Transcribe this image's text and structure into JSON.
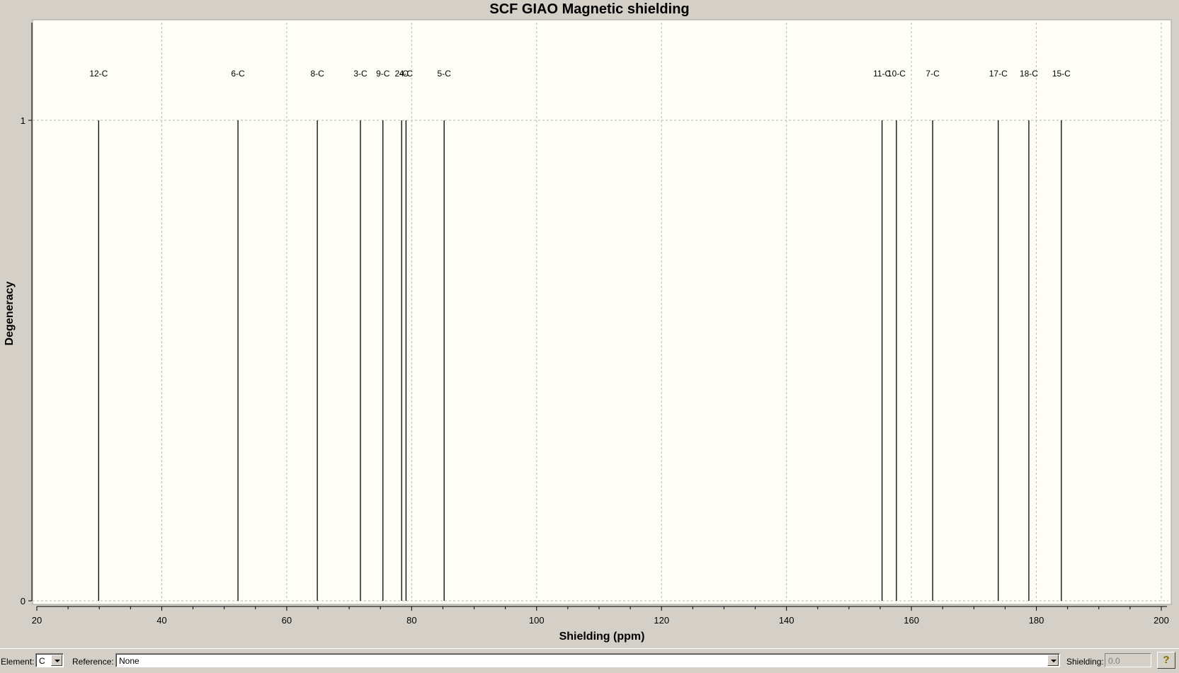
{
  "chart_data": {
    "type": "bar",
    "title": "SCF GIAO Magnetic shielding",
    "xlabel": "Shielding (ppm)",
    "ylabel": "Degeneracy",
    "xlim": [
      20,
      200
    ],
    "ylim": [
      0,
      1.2
    ],
    "xticks": [
      20,
      40,
      60,
      80,
      100,
      120,
      140,
      160,
      180,
      200
    ],
    "yticks": [
      0,
      1
    ],
    "grid": true,
    "peaks": [
      {
        "label": "12-C",
        "x": 29.9,
        "y": 1
      },
      {
        "label": "6-C",
        "x": 52.2,
        "y": 1
      },
      {
        "label": "8-C",
        "x": 64.9,
        "y": 1
      },
      {
        "label": "3-C",
        "x": 71.8,
        "y": 1
      },
      {
        "label": "9-C",
        "x": 75.4,
        "y": 1
      },
      {
        "label": "2-C",
        "x": 78.4,
        "y": 1
      },
      {
        "label": "4-C",
        "x": 79.1,
        "y": 1
      },
      {
        "label": "5-C",
        "x": 85.2,
        "y": 1
      },
      {
        "label": "11-C",
        "x": 155.3,
        "y": 1
      },
      {
        "label": "10-C",
        "x": 157.6,
        "y": 1
      },
      {
        "label": "7-C",
        "x": 163.4,
        "y": 1
      },
      {
        "label": "17-C",
        "x": 173.9,
        "y": 1
      },
      {
        "label": "18-C",
        "x": 178.8,
        "y": 1
      },
      {
        "label": "15-C",
        "x": 184.0,
        "y": 1
      }
    ]
  },
  "controls": {
    "element_label": "Element:",
    "element_value": "C",
    "reference_label": "Reference:",
    "reference_value": "None",
    "shielding_label": "Shielding:",
    "shielding_value": "0.0",
    "help_glyph": "?"
  },
  "colors": {
    "plot_background": "#fefef6",
    "window_background": "#d4d0c8",
    "grid": "#b8b8b8",
    "peak": "#000000"
  }
}
